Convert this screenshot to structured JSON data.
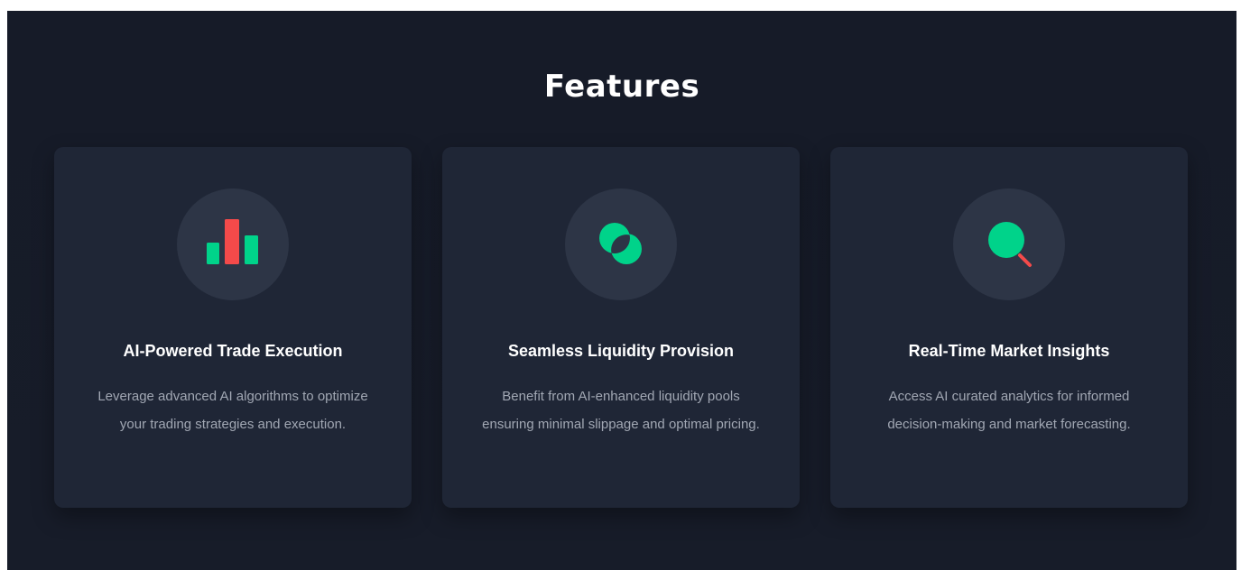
{
  "section": {
    "title": "Features"
  },
  "features": [
    {
      "icon": "bar-chart-icon",
      "title": "AI-Powered Trade Execution",
      "description": "Leverage advanced AI algorithms to optimize your trading strategies and execution."
    },
    {
      "icon": "liquidity-circles-icon",
      "title": "Seamless Liquidity Provision",
      "description": "Benefit from AI-enhanced liquidity pools ensuring minimal slippage and optimal pricing."
    },
    {
      "icon": "magnifier-icon",
      "title": "Real-Time Market Insights",
      "description": "Access AI curated analytics for informed decision-making and market forecasting."
    }
  ],
  "colors": {
    "background": "#161b28",
    "card": "#1f2636",
    "icon_circle": "#2d3546",
    "accent_green": "#00d38a",
    "accent_red": "#f44a4a",
    "text_primary": "#ffffff",
    "text_secondary": "#a1a7b3"
  }
}
